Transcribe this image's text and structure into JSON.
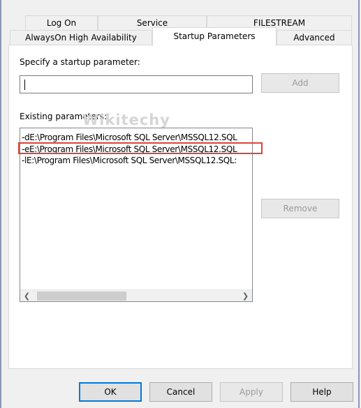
{
  "tabs": {
    "row_back": [
      "Log On",
      "Service",
      "FILESTREAM"
    ],
    "row_front": [
      "AlwaysOn High Availability",
      "Startup Parameters",
      "Advanced"
    ],
    "active": "Startup Parameters"
  },
  "startup": {
    "specify_label": "Specify a startup parameter:",
    "input_value": "",
    "add_label": "Add",
    "existing_label": "Existing parameters:",
    "remove_label": "Remove",
    "parameters": [
      "-dE:\\Program Files\\Microsoft SQL Server\\MSSQL12.SQL",
      "-eE:\\Program Files\\Microsoft SQL Server\\MSSQL12.SQL",
      "-lE:\\Program Files\\Microsoft SQL Server\\MSSQL12.SQL:"
    ],
    "highlighted_index": 1
  },
  "watermark": "Wikitechy",
  "footer": {
    "ok": "OK",
    "cancel": "Cancel",
    "apply": "Apply",
    "help": "Help"
  },
  "colors": {
    "highlight_border": "#e0413a",
    "default_button_border": "#0078d7"
  },
  "icons": {
    "scroll_left": "chevron-left-icon",
    "scroll_right": "chevron-right-icon"
  }
}
